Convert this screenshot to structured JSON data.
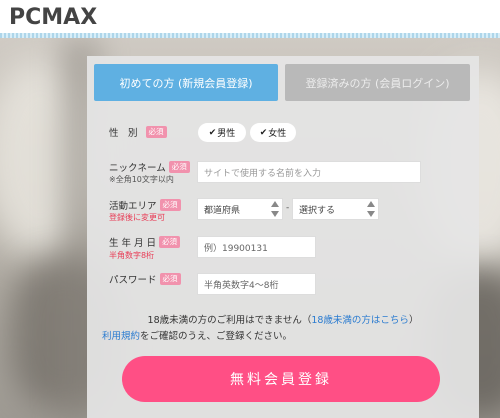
{
  "logo": {
    "text_pc": "PC",
    "text_max": "MAX"
  },
  "tabs": {
    "new": "初めての方 (新規会員登録)",
    "login": "登録済みの方 (会員ログイン)"
  },
  "required_badge": "必須",
  "gender": {
    "label": "性　別",
    "male": "男性",
    "female": "女性",
    "check": "✔"
  },
  "nickname": {
    "label": "ニックネーム",
    "note": "※全角10文字以内",
    "placeholder": "サイトで使用する名前を入力"
  },
  "area": {
    "label": "活動エリア",
    "note": "登録後に変更可",
    "prefecture": "都道府県",
    "dash": "-",
    "city": "選択する"
  },
  "birthday": {
    "label": "生 年 月 日",
    "note": "半角数字8桁",
    "placeholder": "例）19900131"
  },
  "password": {
    "label": "パスワード",
    "placeholder": "半角英数字4〜8桁"
  },
  "notice": {
    "line1_a": "18歳未満の方のご利用はできません（",
    "line1_link": "18歳未満の方はこちら",
    "line1_b": "）",
    "line2_link": "利用規約",
    "line2_b": "をご確認のうえ、ご登録ください。"
  },
  "cta": "無料会員登録",
  "colors": {
    "tab_active": "#5fb0e2",
    "tab_inactive": "#b9b9b9",
    "required": "#f192ad",
    "cta": "#ff4f85",
    "link": "#2a7bd0",
    "note_red": "#e83b55"
  }
}
